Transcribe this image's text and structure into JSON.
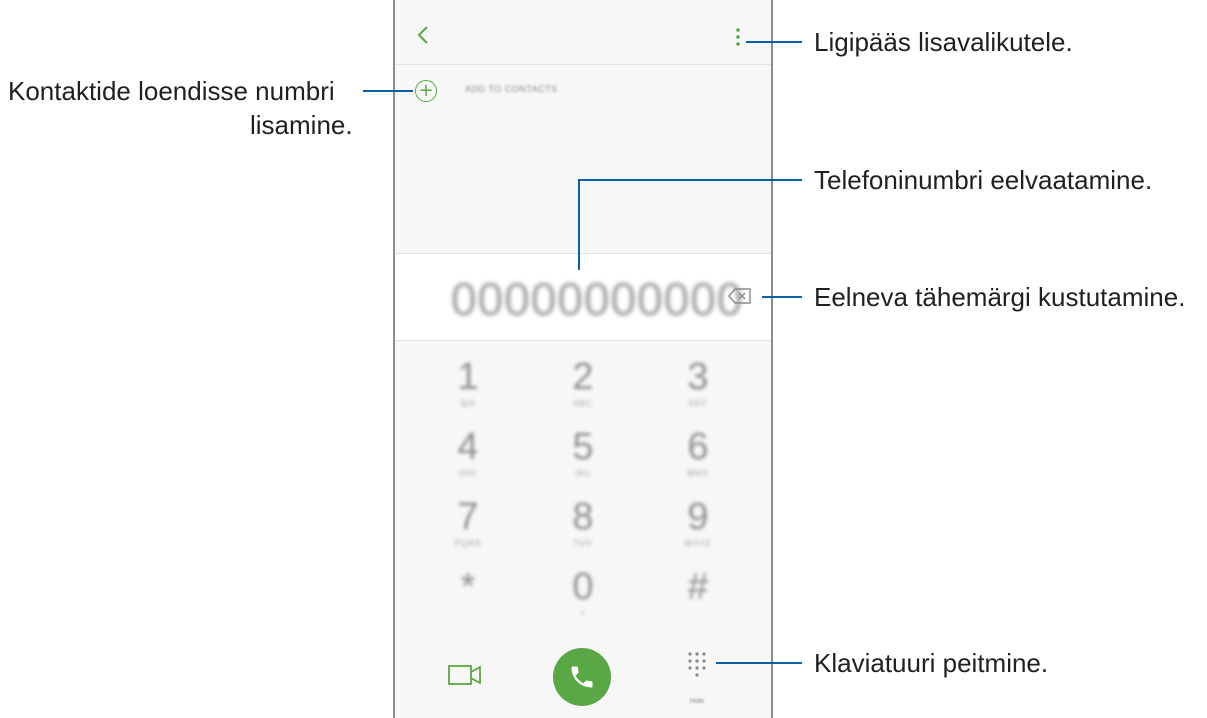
{
  "dialer": {
    "add_to_contacts": "ADD TO CONTACTS",
    "number": "00000000000",
    "hide_label": "Hide",
    "keys": [
      {
        "digit": "1",
        "letters": "QO"
      },
      {
        "digit": "2",
        "letters": "ABC"
      },
      {
        "digit": "3",
        "letters": "DEF"
      },
      {
        "digit": "4",
        "letters": "GHI"
      },
      {
        "digit": "5",
        "letters": "JKL"
      },
      {
        "digit": "6",
        "letters": "MNO"
      },
      {
        "digit": "7",
        "letters": "PQRS"
      },
      {
        "digit": "8",
        "letters": "TUV"
      },
      {
        "digit": "9",
        "letters": "WXYZ"
      },
      {
        "digit": "*",
        "letters": ""
      },
      {
        "digit": "0",
        "letters": "+"
      },
      {
        "digit": "#",
        "letters": ""
      }
    ],
    "accent_color": "#5aa845"
  },
  "callouts": {
    "more_options": "Ligipääs lisavalikutele.",
    "add_to_contacts_line1": "Kontaktide loendisse numbri",
    "add_to_contacts_line2": "lisamine.",
    "preview_number": "Telefoninumbri eelvaatamine.",
    "delete_char": "Eelneva tähemärgi kustutamine.",
    "hide_keypad": "Klaviatuuri peitmine."
  },
  "callout_line_color": "#0b5ea8",
  "icons": [
    "back-arrow-icon",
    "more-options-icon",
    "add-contact-icon",
    "backspace-icon",
    "video-call-icon",
    "phone-icon",
    "keypad-grid-icon"
  ]
}
